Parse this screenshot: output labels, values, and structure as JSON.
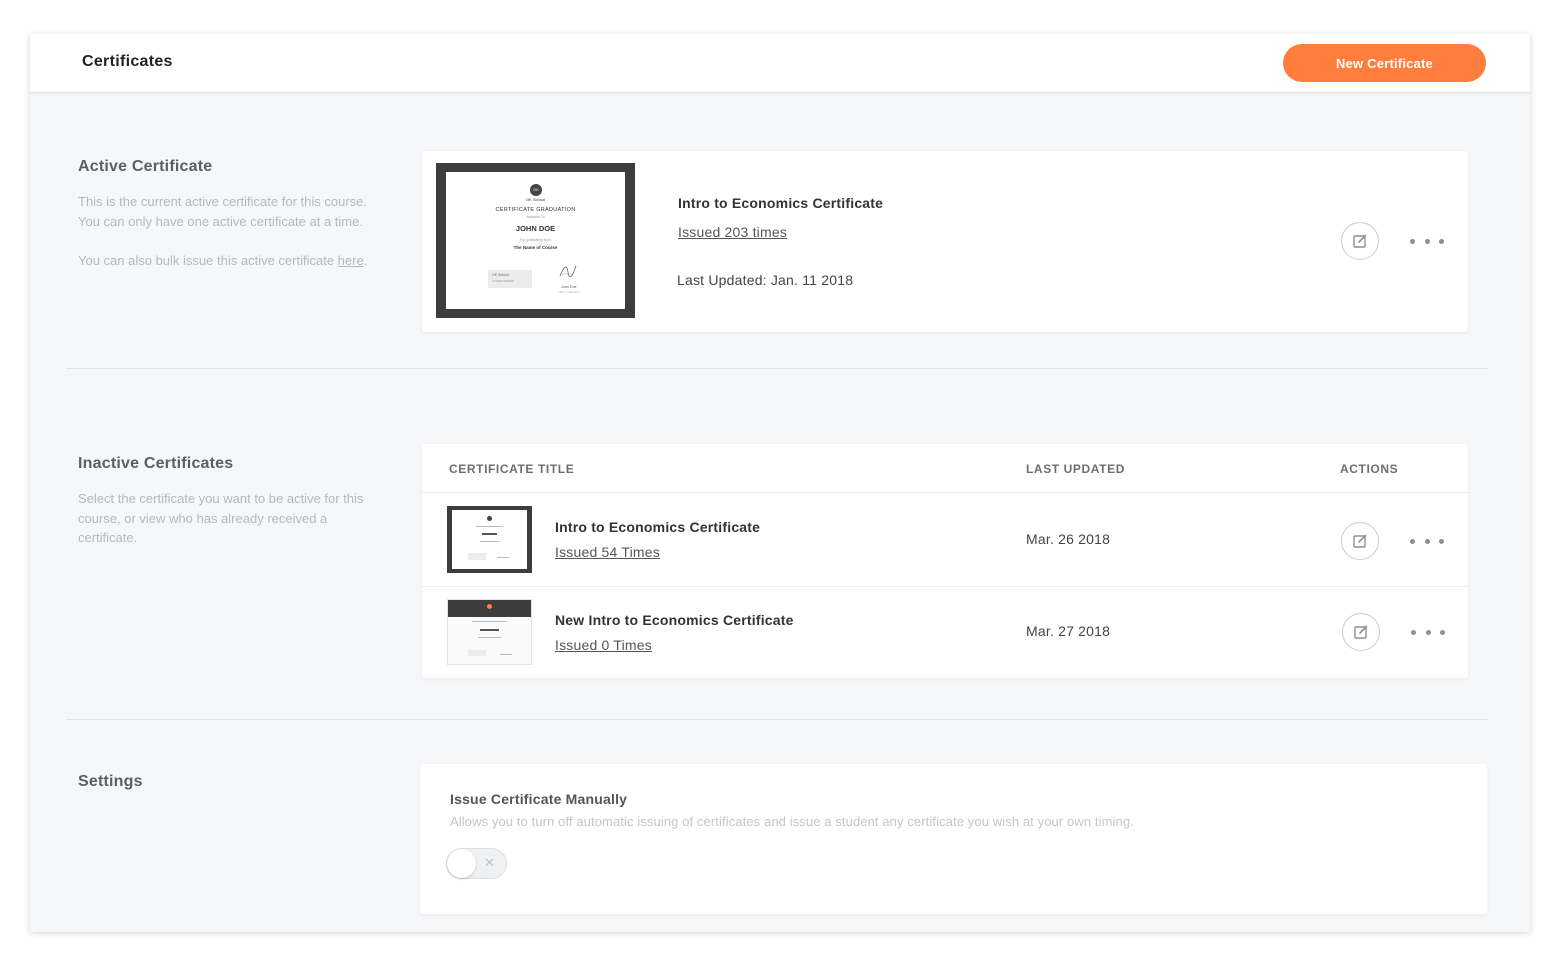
{
  "header": {
    "title": "Certificates",
    "new_button": "New Certificate"
  },
  "active_section": {
    "title": "Active Certificate",
    "desc_1": "This is the current active certificate for this course. You can only have one active certificate at a time.",
    "desc_2_prefix": "You can also bulk issue this active certificate ",
    "desc_2_link": "here",
    "desc_2_suffix": ".",
    "certificate": {
      "title": "Intro to Economics Certificate",
      "issued": "Issued 203 times",
      "last_updated": "Last Updated: Jan. 11 2018"
    },
    "thumbnail": {
      "seal": "OK",
      "school": "OK School",
      "heading": "CERTIFICATE GRADUATION",
      "awarded": "Awarded To",
      "name": "JOHN DOE",
      "for": "For graduating from",
      "course": "The Name of Course",
      "left_box_title": "OK School",
      "left_box_number": "1234567890098",
      "signer": "John Doe",
      "signer_role": "CEO / Instructor"
    }
  },
  "inactive_section": {
    "title": "Inactive Certificates",
    "desc": "Select the certificate you want to be active for this course, or view who has already received a certificate.",
    "columns": {
      "title": "CERTIFICATE TITLE",
      "updated": "LAST UPDATED",
      "actions": "ACTIONS"
    },
    "rows": [
      {
        "title": "Intro to Economics Certificate",
        "issued": "Issued 54 Times",
        "updated": "Mar. 26 2018"
      },
      {
        "title": "New Intro to Economics Certificate",
        "issued": "Issued 0 Times",
        "updated": "Mar. 27 2018"
      }
    ]
  },
  "settings_section": {
    "title": "Settings",
    "manual": {
      "title": "Issue Certificate Manually",
      "desc": "Allows you to turn off automatic issuing of certificates and issue a student any certificate you wish at your own timing.",
      "enabled": false
    }
  },
  "colors": {
    "accent": "#ff7d3d",
    "background": "#f6f7f8"
  }
}
